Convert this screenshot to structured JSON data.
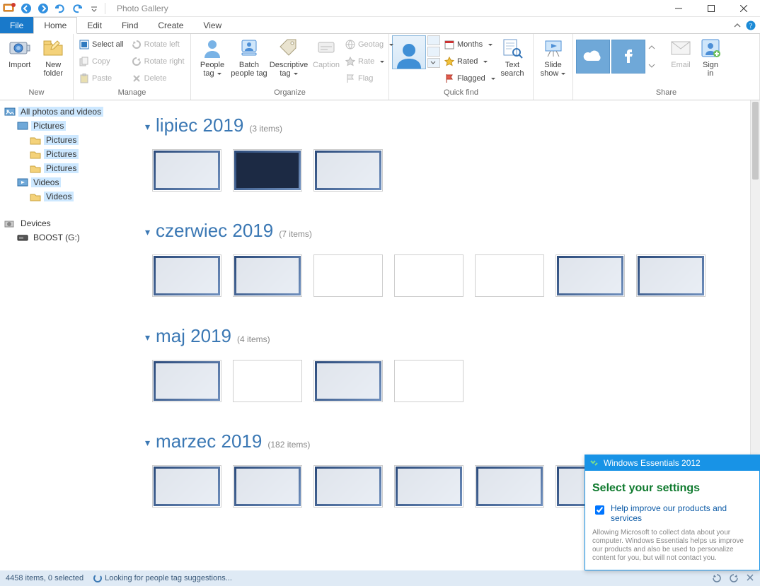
{
  "app": {
    "title": "Photo Gallery"
  },
  "tabs": {
    "file": "File",
    "home": "Home",
    "edit": "Edit",
    "find": "Find",
    "create": "Create",
    "view": "View"
  },
  "ribbon": {
    "new": {
      "label": "New",
      "import": "Import",
      "newfolder_l1": "New",
      "newfolder_l2": "folder"
    },
    "manage": {
      "label": "Manage",
      "selectall": "Select all",
      "copy": "Copy",
      "paste": "Paste",
      "rotleft": "Rotate left",
      "rotright": "Rotate right",
      "delete": "Delete"
    },
    "organize": {
      "label": "Organize",
      "peopletag_l1": "People",
      "peopletag_l2": "tag",
      "batch_l1": "Batch",
      "batch_l2": "people tag",
      "desctag_l1": "Descriptive",
      "desctag_l2": "tag",
      "caption": "Caption",
      "geotag": "Geotag",
      "rate": "Rate",
      "flag": "Flag"
    },
    "quick": {
      "label": "Quick find",
      "months": "Months",
      "rated": "Rated",
      "flagged": "Flagged",
      "textsearch_l1": "Text",
      "textsearch_l2": "search"
    },
    "publish": {
      "label": "",
      "slideshow_l1": "Slide",
      "slideshow_l2": "show"
    },
    "share": {
      "label": "Share",
      "email": "Email",
      "signin_l1": "Sign",
      "signin_l2": "in"
    }
  },
  "nav": {
    "root": "All photos and videos",
    "pictures": "Pictures",
    "pictures_a": "Pictures",
    "pictures_b": "Pictures",
    "pictures_c": "Pictures",
    "videos": "Videos",
    "videos_a": "Videos",
    "devices": "Devices",
    "boost": "BOOST (G:)"
  },
  "groups": [
    {
      "name": "lipiec 2019",
      "count": "(3 items)",
      "thumbs": 3
    },
    {
      "name": "czerwiec 2019",
      "count": "(7 items)",
      "thumbs": 7
    },
    {
      "name": "maj 2019",
      "count": "(4 items)",
      "thumbs": 4
    },
    {
      "name": "marzec 2019",
      "count": "(182 items)",
      "thumbs": 7
    }
  ],
  "popup": {
    "title": "Windows Essentials 2012",
    "heading": "Select your settings",
    "checkbox": "Help improve our products and services",
    "fine": "Allowing Microsoft to collect data about your computer. Windows Essentials helps us improve our products and also be used to personalize content for you, but will not contact you."
  },
  "status": {
    "left": "4458 items, 0 selected",
    "mid": "Looking for people tag suggestions..."
  }
}
